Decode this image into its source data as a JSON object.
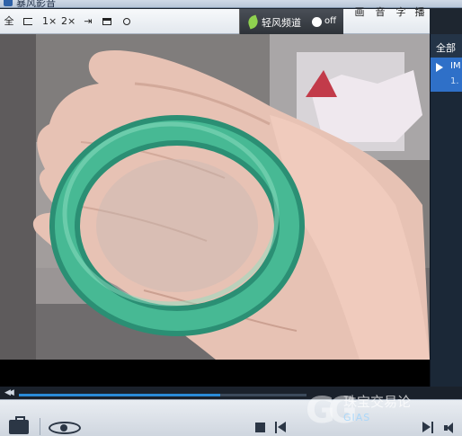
{
  "window": {
    "title": "暴风影音"
  },
  "toolbar": {
    "fullscreen": "全",
    "rate_1x": "1×",
    "rate_2x": "2×",
    "fresh_mode_label": "轻风频道",
    "fresh_mode_state": "off",
    "right_buttons": [
      "画",
      "音",
      "字",
      "播"
    ]
  },
  "playlist": {
    "header": "全部",
    "items": [
      {
        "name": "IM",
        "sub": "1."
      }
    ]
  },
  "playback": {
    "progress": 0.7
  },
  "watermark": {
    "line1": "珠宝交易论",
    "line2": "GIAS"
  },
  "colors": {
    "accent": "#2a8bd8",
    "playlist_selected": "#2f70c8",
    "jade": "#3fae8a"
  }
}
